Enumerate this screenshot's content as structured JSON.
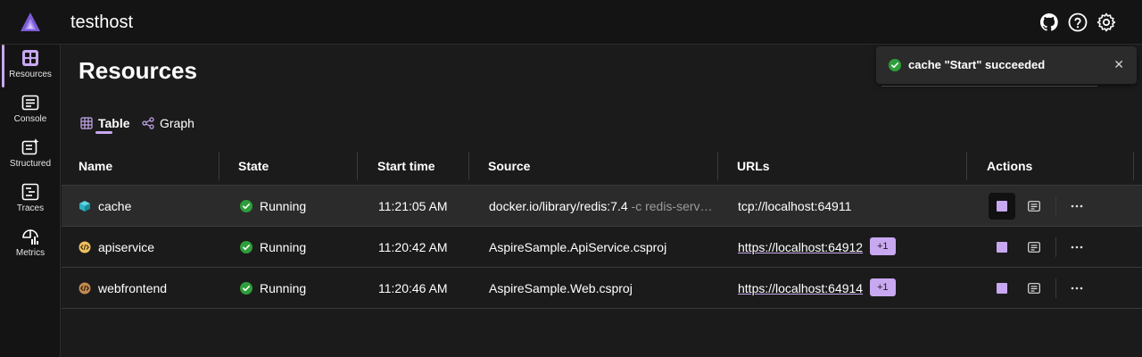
{
  "app": {
    "title": "testhost"
  },
  "nav": {
    "items": [
      {
        "label": "Resources",
        "icon": "resources-icon"
      },
      {
        "label": "Console",
        "icon": "console-icon"
      },
      {
        "label": "Structured",
        "icon": "structured-icon"
      },
      {
        "label": "Traces",
        "icon": "traces-icon"
      },
      {
        "label": "Metrics",
        "icon": "metrics-icon"
      }
    ]
  },
  "page": {
    "title": "Resources"
  },
  "tabs": [
    {
      "label": "Table",
      "icon": "table-icon"
    },
    {
      "label": "Graph",
      "icon": "graph-icon"
    }
  ],
  "table": {
    "columns": [
      "Name",
      "State",
      "Start time",
      "Source",
      "URLs",
      "Actions"
    ],
    "rows": [
      {
        "name": "cache",
        "state": "Running",
        "start_time": "11:21:05 AM",
        "source": "docker.io/library/redis:7.4",
        "source_args": "-c redis-serv…",
        "url": "tcp://localhost:64911",
        "url_badge": ""
      },
      {
        "name": "apiservice",
        "state": "Running",
        "start_time": "11:20:42 AM",
        "source": "AspireSample.ApiService.csproj",
        "source_args": "",
        "url": "https://localhost:64912",
        "url_badge": "+1"
      },
      {
        "name": "webfrontend",
        "state": "Running",
        "start_time": "11:20:46 AM",
        "source": "AspireSample.Web.csproj",
        "source_args": "",
        "url": "https://localhost:64914",
        "url_badge": "+1"
      }
    ]
  },
  "toast": {
    "message": "cache \"Start\" succeeded",
    "close_label": "✕"
  },
  "colors": {
    "accent": "#c8a8f0",
    "success": "#2e9e3a",
    "background": "#1b1b1b",
    "chrome": "#141414"
  }
}
